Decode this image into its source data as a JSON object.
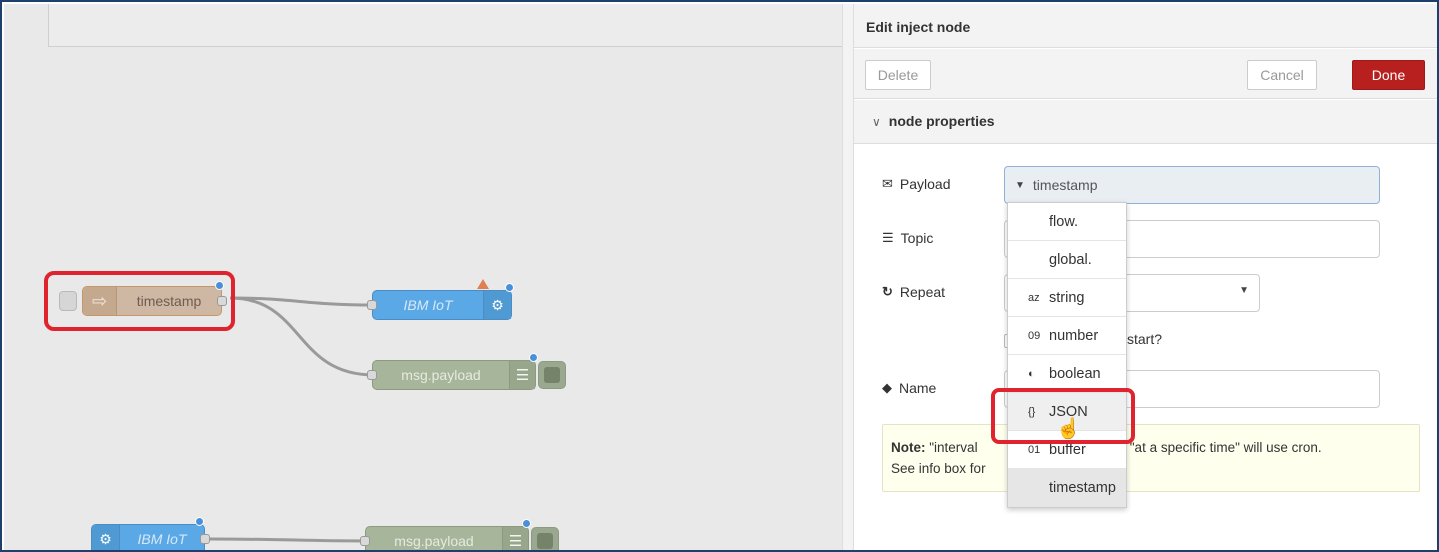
{
  "workspace": {
    "nodes": {
      "inject": {
        "label": "timestamp"
      },
      "iot_out": {
        "label": "IBM IoT"
      },
      "debug_1": {
        "label": "msg.payload"
      },
      "iot_in": {
        "label": "IBM IoT"
      },
      "debug_2": {
        "label": "msg.payload"
      }
    }
  },
  "panel": {
    "title": "Edit inject node",
    "delete_label": "Delete",
    "cancel_label": "Cancel",
    "done_label": "Done",
    "section_title": "node properties",
    "payload_label": "Payload",
    "payload_value": "timestamp",
    "topic_label": "Topic",
    "repeat_label": "Repeat",
    "once_text": "start?",
    "name_label": "Name",
    "note_bold": "Note:",
    "note_left": " \"interval",
    "note_right": "nd \"at a specific time\" will use cron.",
    "note_line2": "See info box for"
  },
  "dropdown": {
    "items": [
      {
        "icon": "",
        "label": "flow."
      },
      {
        "icon": "",
        "label": "global."
      },
      {
        "icon": "az",
        "label": "string"
      },
      {
        "icon": "09",
        "label": "number"
      },
      {
        "icon": "◐",
        "label": "boolean"
      },
      {
        "icon": "{}",
        "label": "JSON"
      },
      {
        "icon": "01",
        "label": "buffer"
      },
      {
        "icon": "",
        "label": "timestamp"
      }
    ]
  },
  "colors": {
    "highlight": "#e0242f",
    "done_button": "#b81f1f",
    "iot_node": "#5aa9e6",
    "debug_node": "#a7b59b",
    "inject_node": "#cfb8a3"
  }
}
